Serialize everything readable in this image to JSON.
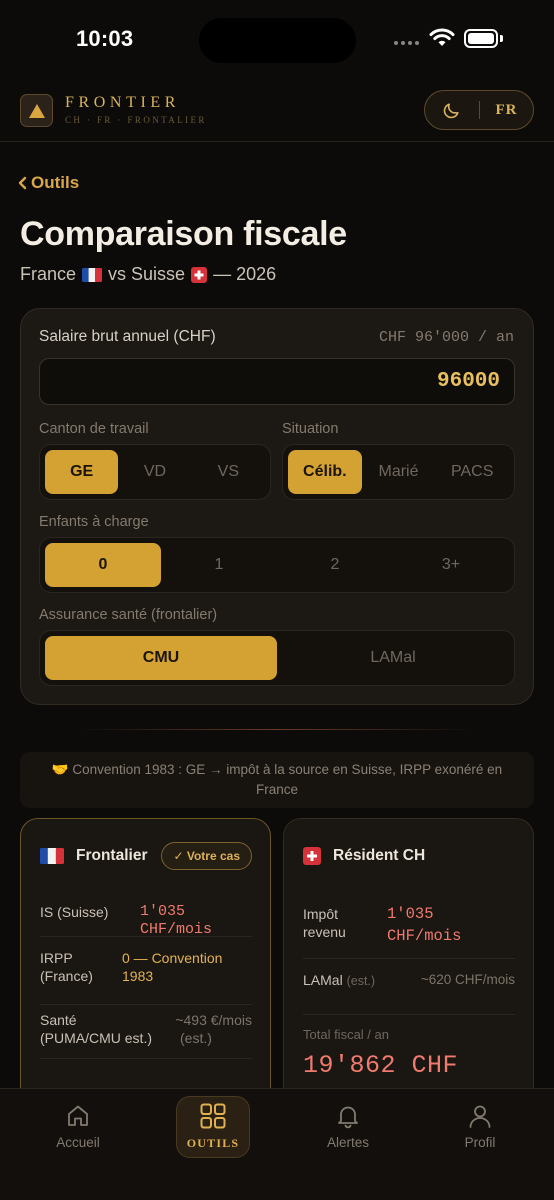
{
  "status_bar": {
    "time": "10:03"
  },
  "header": {
    "brand": "FRONTIER",
    "brand_sub": "CH · FR · FRONTALIER",
    "lang": "FR"
  },
  "back_label": "Outils",
  "page": {
    "title": "Comparaison fiscale",
    "sub_fr": "France",
    "sub_vs": "vs Suisse",
    "sub_year": "— 2026"
  },
  "form": {
    "salary_label": "Salaire brut annuel (CHF)",
    "salary_hint": "CHF 96'000 / an",
    "salary_value": "96000",
    "canton_label": "Canton de travail",
    "canton_options": [
      "GE",
      "VD",
      "VS"
    ],
    "canton_selected": "GE",
    "situation_label": "Situation",
    "situation_options": [
      "Célib.",
      "Marié",
      "PACS"
    ],
    "situation_selected": "Célib.",
    "children_label": "Enfants à charge",
    "children_options": [
      "0",
      "1",
      "2",
      "3+"
    ],
    "children_selected": "0",
    "insurance_label": "Assurance santé (frontalier)",
    "insurance_options": [
      "CMU",
      "LAMal"
    ],
    "insurance_selected": "CMU"
  },
  "banner": {
    "text": "Convention 1983 : GE → impôt à la source en Suisse, IRPP exonéré en France"
  },
  "frontalier": {
    "title": "Frontalier",
    "badge": "✓ Votre cas",
    "rows": [
      {
        "label": "IS (Suisse)",
        "value": "1'035 CHF/mois"
      },
      {
        "label_1": "IRPP",
        "label_2": "(France)",
        "value_1": "0 — Convention",
        "value_2": "1983"
      },
      {
        "label_1": "Santé",
        "label_2": "(PUMA/CMU est.)",
        "value_1": "~493 €/mois",
        "value_2": "(est.)"
      }
    ]
  },
  "resident": {
    "title": "Résident CH",
    "rows": [
      {
        "label_1": "Impôt",
        "label_2": "revenu",
        "value_1": "1'035",
        "value_2": "CHF/mois"
      },
      {
        "label": "LAMal",
        "label_note": "(est.)",
        "value": "~620 CHF/mois"
      }
    ],
    "total_label": "Total fiscal / an",
    "total_value": "19'862 CHF"
  },
  "nav": {
    "items": [
      "Accueil",
      "OUTILS",
      "Alertes",
      "Profil"
    ],
    "active": "OUTILS"
  },
  "colors": {
    "accent": "#d4a233",
    "background": "#0d0b09",
    "negative": "#f07a6e"
  }
}
